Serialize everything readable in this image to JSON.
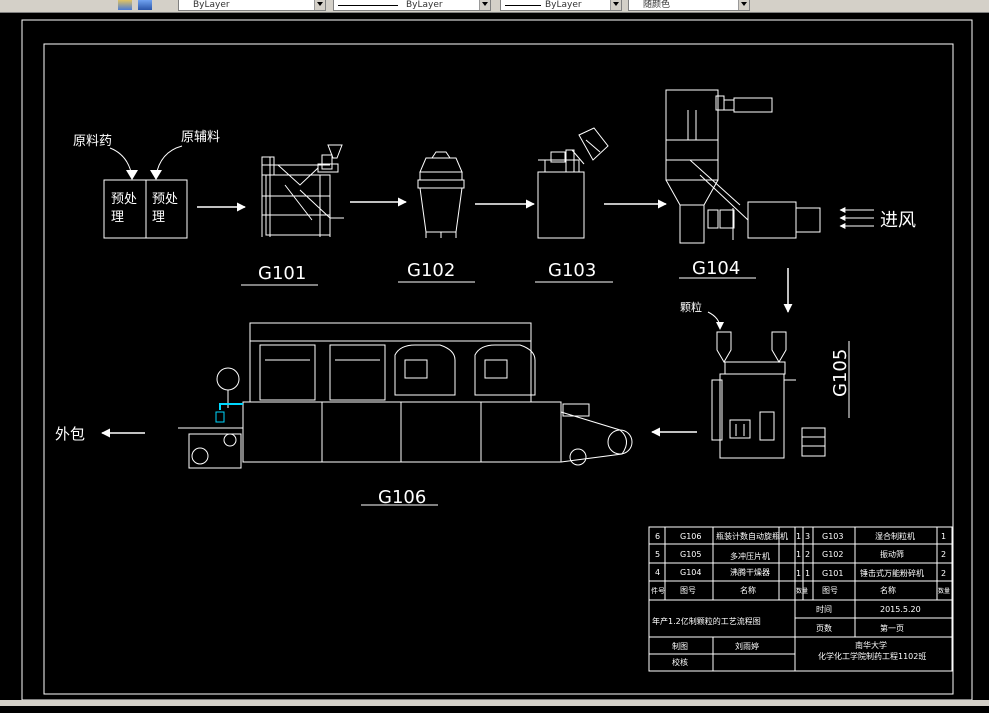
{
  "toolbar": {
    "color_select": "ByLayer",
    "linetype_select": "ByLayer",
    "lineweight_select": "ByLayer",
    "plotstyle_select": "随颜色"
  },
  "drawing": {
    "labels": {
      "raw_drug": "原料药",
      "raw_excipient": "原辅料",
      "pretreat1": "预处理",
      "pretreat2": "预处理",
      "air_inlet": "进风",
      "granules": "颗粒",
      "outer_pack": "外包"
    },
    "equipment_codes": [
      "G101",
      "G102",
      "G103",
      "G104",
      "G105",
      "G106"
    ]
  },
  "title_block": {
    "rows": [
      {
        "no": "6",
        "code": "G106",
        "name": "瓶装计数自动旋瓶机",
        "qty": "1",
        "no2": "3",
        "code2": "G103",
        "name2": "湿合制粒机",
        "qty2": "1"
      },
      {
        "no": "5",
        "code": "G105",
        "name": "多冲压片机",
        "qty": "1",
        "no2": "2",
        "code2": "G102",
        "name2": "振动筛",
        "qty2": "2"
      },
      {
        "no": "4",
        "code": "G104",
        "name": "沸腾干燥器",
        "qty": "1",
        "no2": "1",
        "code2": "G101",
        "name2": "锤击式万能粉碎机",
        "qty2": "2"
      }
    ],
    "header": {
      "no": "件号",
      "code": "图号",
      "name": "名称",
      "qty": "数量"
    },
    "drawing_title": "年产1.2亿制颗粒的工艺流程图",
    "time_label": "时间",
    "time_value": "2015.5.20",
    "pages_label": "页数",
    "pages_value": "第一页",
    "drawn_label": "制图",
    "drawn_value": "刘雨婷",
    "checked_label": "校核",
    "school": "南华大学",
    "dept": "化学化工学院制药工程1102班"
  },
  "colors": {
    "background": "#000000",
    "lines": "#ffffff",
    "accent": "#00d8ff"
  }
}
